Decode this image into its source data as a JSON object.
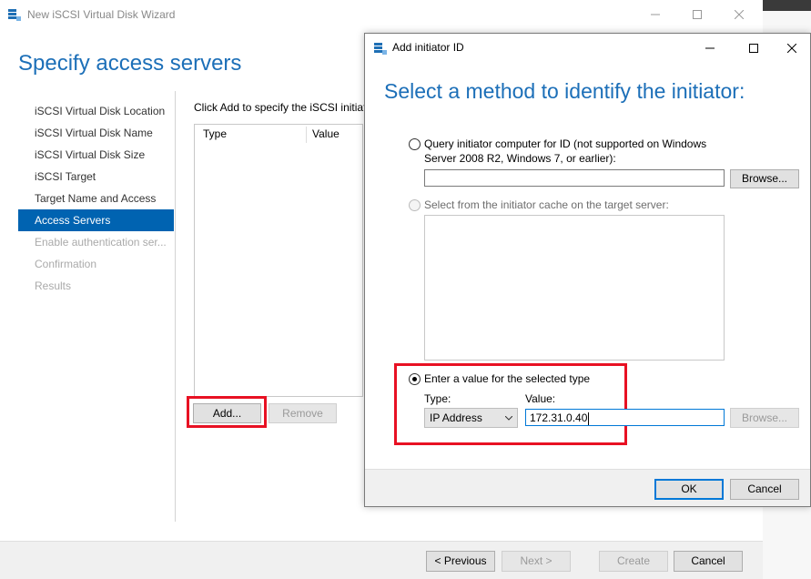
{
  "wizard": {
    "title": "New iSCSI Virtual Disk Wizard",
    "heading": "Specify access servers",
    "nav": [
      {
        "label": "iSCSI Virtual Disk Location",
        "state": "normal"
      },
      {
        "label": "iSCSI Virtual Disk Name",
        "state": "normal"
      },
      {
        "label": "iSCSI Virtual Disk Size",
        "state": "normal"
      },
      {
        "label": "iSCSI Target",
        "state": "normal"
      },
      {
        "label": "Target Name and Access",
        "state": "normal"
      },
      {
        "label": "Access Servers",
        "state": "active"
      },
      {
        "label": "Enable authentication ser...",
        "state": "disabled"
      },
      {
        "label": "Confirmation",
        "state": "disabled"
      },
      {
        "label": "Results",
        "state": "disabled"
      }
    ],
    "instruction": "Click Add to specify the iSCSI initiat",
    "list_headers": {
      "type": "Type",
      "value": "Value"
    },
    "add_label": "Add...",
    "remove_label": "Remove",
    "footer": {
      "previous": "< Previous",
      "next": "Next >",
      "create": "Create",
      "cancel": "Cancel"
    }
  },
  "dialog": {
    "title": "Add initiator ID",
    "heading": "Select a method to identify the initiator:",
    "option_query_line1": "Query initiator computer for ID (not supported on Windows",
    "option_query_line2": "Server 2008 R2, Windows 7, or earlier):",
    "query_value": "",
    "browse_label": "Browse...",
    "option_cache": "Select from the initiator cache on the target server:",
    "option_value": "Enter a value for the selected type",
    "type_label": "Type:",
    "value_label": "Value:",
    "type_selected": "IP Address",
    "value_input": "172.31.0.40",
    "browse2_label": "Browse...",
    "ok_label": "OK",
    "cancel_label": "Cancel"
  },
  "colors": {
    "accent": "#0063b1",
    "heading": "#1c6fb8",
    "highlight": "#e81123"
  }
}
